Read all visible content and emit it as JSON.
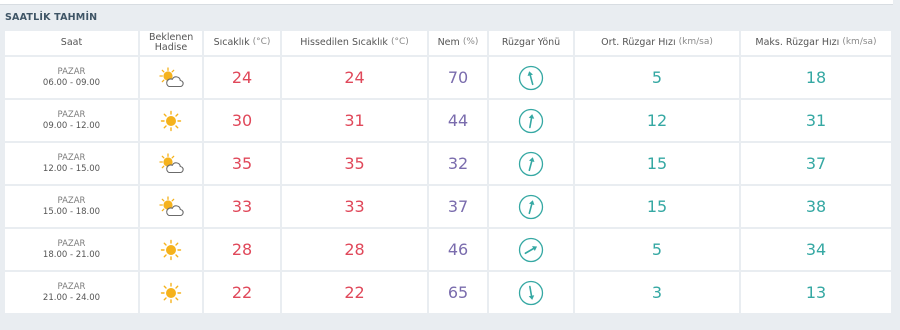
{
  "section_title": "SAATLİK TAHMİN",
  "headers": {
    "time": "Saat",
    "event": "Beklenen Hadise",
    "temp": "Sıcaklık",
    "temp_unit": "(°C)",
    "feels": "Hissedilen Sıcaklık",
    "feels_unit": "(°C)",
    "humidity": "Nem",
    "humidity_unit": "(%)",
    "wind_dir": "Rüzgar Yönü",
    "wind_avg": "Ort. Rüzgar Hızı",
    "wind_avg_unit": "(km/sa)",
    "wind_max": "Maks. Rüzgar Hızı",
    "wind_max_unit": "(km/sa)"
  },
  "rows": [
    {
      "day": "PAZAR",
      "time": "06.00 - 09.00",
      "icon": "partly-cloudy-icon",
      "temp": "24",
      "feels": "24",
      "humidity": "70",
      "wind_dir_deg": 165,
      "wind_avg": "5",
      "wind_max": "18"
    },
    {
      "day": "PAZAR",
      "time": "09.00 - 12.00",
      "icon": "sunny-icon",
      "temp": "30",
      "feels": "31",
      "humidity": "44",
      "wind_dir_deg": 190,
      "wind_avg": "12",
      "wind_max": "31"
    },
    {
      "day": "PAZAR",
      "time": "12.00 - 15.00",
      "icon": "partly-cloudy-icon",
      "temp": "35",
      "feels": "35",
      "humidity": "32",
      "wind_dir_deg": 195,
      "wind_avg": "15",
      "wind_max": "37"
    },
    {
      "day": "PAZAR",
      "time": "15.00 - 18.00",
      "icon": "partly-cloudy-icon",
      "temp": "33",
      "feels": "33",
      "humidity": "37",
      "wind_dir_deg": 195,
      "wind_avg": "15",
      "wind_max": "38"
    },
    {
      "day": "PAZAR",
      "time": "18.00 - 21.00",
      "icon": "sunny-icon",
      "temp": "28",
      "feels": "28",
      "humidity": "46",
      "wind_dir_deg": 240,
      "wind_avg": "5",
      "wind_max": "34"
    },
    {
      "day": "PAZAR",
      "time": "21.00 - 24.00",
      "icon": "sunny-icon",
      "temp": "22",
      "feels": "22",
      "humidity": "65",
      "wind_dir_deg": 350,
      "wind_avg": "3",
      "wind_max": "13"
    }
  ],
  "colors": {
    "temp": "#e0485a",
    "humidity": "#7a6cad",
    "wind": "#35a8a3",
    "compass": "#35a8a3",
    "sun": "#f5b21c",
    "cloud": "#6b6b6b"
  }
}
